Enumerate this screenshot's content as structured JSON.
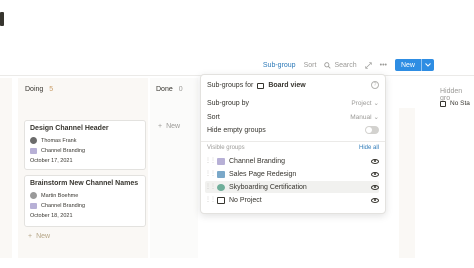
{
  "toolbar": {
    "subgroup": "Sub-group",
    "sort": "Sort",
    "search": "Search",
    "expand_icon": "expand-icon",
    "more_icon": "more-icon",
    "new_label": "New"
  },
  "board": {
    "columns": [
      {
        "name": "Doing",
        "count": "5"
      },
      {
        "name": "Done",
        "count": "0"
      }
    ],
    "cards": [
      {
        "title": "Design Channel Header",
        "person": "Thomas Frank",
        "project": "Channel Branding",
        "date": "October 17, 2021"
      },
      {
        "title": "Brainstorm New Channel Names",
        "person": "Martin Boehme",
        "project": "Channel Branding",
        "date": "October 18, 2021"
      }
    ],
    "add_new": "New",
    "hidden_groups_label": "Hidden gro",
    "hidden_item": "No Sta"
  },
  "popup": {
    "title_prefix": "Sub-groups for",
    "title_view": "Board view",
    "subgroup_by": {
      "label": "Sub-group by",
      "value": "Project"
    },
    "sort": {
      "label": "Sort",
      "value": "Manual"
    },
    "hide_empty": {
      "label": "Hide empty groups",
      "on": false
    },
    "visible_groups_label": "Visible groups",
    "hide_all": "Hide all",
    "groups": [
      {
        "label": "Channel Branding",
        "icon_color": "#b7b0d6"
      },
      {
        "label": "Sales Page Redesign",
        "icon_color": "#7aa8c9"
      },
      {
        "label": "Skyboarding Certification",
        "icon_color": "#6fae9a"
      },
      {
        "label": "No Project",
        "icon_color": "#37352f"
      }
    ]
  }
}
